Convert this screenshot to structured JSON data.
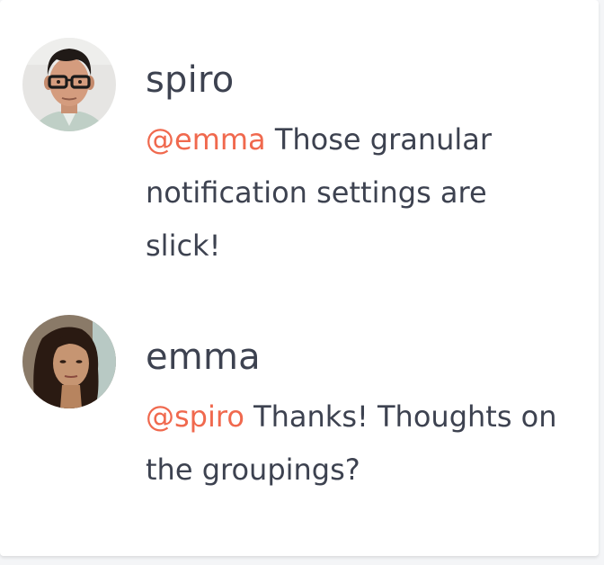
{
  "colors": {
    "mention": "#f0694e",
    "text": "#3d4250",
    "card_background": "#ffffff",
    "page_background": "#f4f5f7"
  },
  "comments": [
    {
      "author": "spiro",
      "avatar_icon": "avatar-spiro-photo",
      "mention": "@emma",
      "text": "Those granular notification settings are slick!"
    },
    {
      "author": "emma",
      "avatar_icon": "avatar-emma-photo",
      "mention": "@spiro",
      "text": "Thanks! Thoughts on the groupings?"
    }
  ]
}
